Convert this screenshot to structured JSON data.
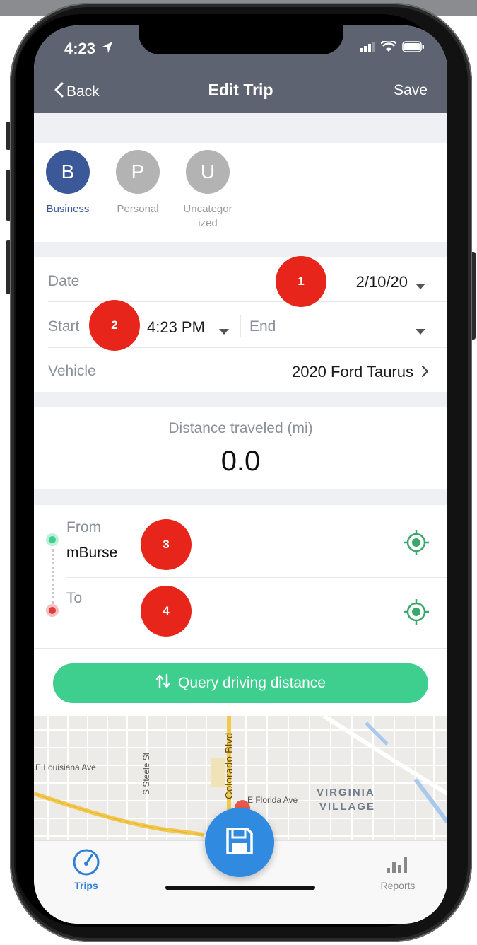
{
  "status": {
    "time": "4:23"
  },
  "nav": {
    "back": "Back",
    "title": "Edit Trip",
    "save": "Save"
  },
  "categories": [
    {
      "letter": "B",
      "label": "Business",
      "color": "#3b5998",
      "selected": true
    },
    {
      "letter": "P",
      "label": "Personal",
      "color": "#b3b3b3",
      "selected": false
    },
    {
      "letter": "U",
      "label": "Uncategorized",
      "label_line1": "Uncategor",
      "label_line2": "ized",
      "color": "#b3b3b3",
      "selected": false
    }
  ],
  "trip": {
    "date_label": "Date",
    "date_value": "2/10/20",
    "start_label": "Start",
    "start_value": "4:23 PM",
    "end_label": "End",
    "vehicle_label": "Vehicle",
    "vehicle_value": "2020 Ford Taurus"
  },
  "distance": {
    "label": "Distance traveled (mi)",
    "value": "0.0"
  },
  "route": {
    "from_label": "From",
    "from_value": "mBurse",
    "to_label": "To"
  },
  "query_button": "Query driving distance",
  "map_labels": {
    "e_louisiana": "E Louisiana Ave",
    "s_steele": "S Steele St",
    "colorado": "Colorado Blvd",
    "e_florida": "E Florida Ave",
    "virginia": "VIRGINIA",
    "village": "VILLAGE"
  },
  "tabs": {
    "trips": "Trips",
    "reports": "Reports"
  },
  "badges": [
    "1",
    "2",
    "3",
    "4"
  ],
  "colors": {
    "header": "#5d6370",
    "business": "#3b5998",
    "green": "#3ecf8e",
    "badge": "#e8251a",
    "fab": "#2f8ae0",
    "tab_active": "#2f7fd6"
  }
}
